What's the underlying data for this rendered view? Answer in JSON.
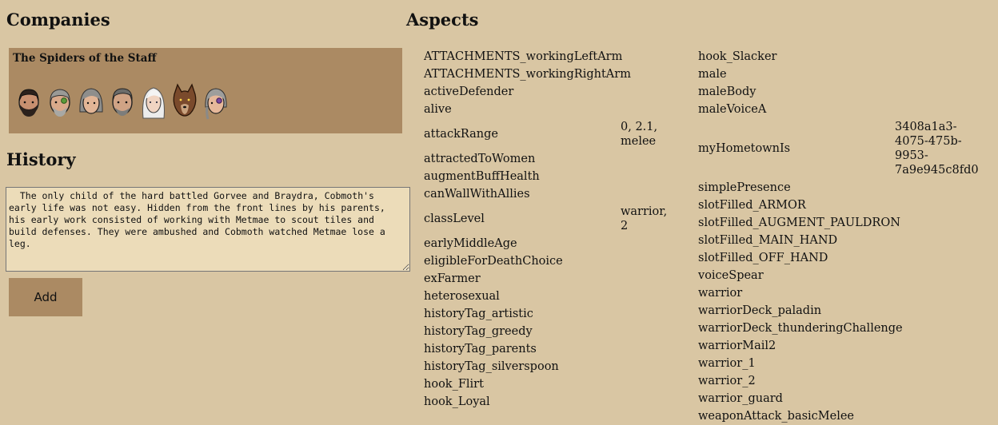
{
  "companies": {
    "heading": "Companies",
    "company_name": "The Spiders of the Staff",
    "portraits": [
      {
        "icon": "bearded-man-portrait"
      },
      {
        "icon": "old-man-green-eye-portrait"
      },
      {
        "icon": "grey-haired-woman-portrait"
      },
      {
        "icon": "grey-haired-man-portrait"
      },
      {
        "icon": "white-haired-elf-portrait"
      },
      {
        "icon": "wolf-portrait"
      },
      {
        "icon": "braided-woman-portrait"
      }
    ]
  },
  "history": {
    "heading": "History",
    "text": "  The only child of the hard battled Gorvee and Braydra, Cobmoth's early life was not easy. Hidden from the front lines by his parents, his early work consisted of working with Metmae to scout tiles and build defenses. They were ambushed and Cobmoth watched Metmae lose a leg.",
    "add_label": "Add"
  },
  "aspects": {
    "heading": "Aspects",
    "column1": [
      {
        "key": "ATTACHMENTS_workingLeftArm",
        "value": ""
      },
      {
        "key": "ATTACHMENTS_workingRightArm",
        "value": ""
      },
      {
        "key": "activeDefender",
        "value": ""
      },
      {
        "key": "alive",
        "value": ""
      },
      {
        "key": "attackRange",
        "value": "0, 2.1,\nmelee"
      },
      {
        "key": "attractedToWomen",
        "value": ""
      },
      {
        "key": "augmentBuffHealth",
        "value": ""
      },
      {
        "key": "canWallWithAllies",
        "value": ""
      },
      {
        "key": "classLevel",
        "value": "warrior,\n2"
      },
      {
        "key": "earlyMiddleAge",
        "value": ""
      },
      {
        "key": "eligibleForDeathChoice",
        "value": ""
      },
      {
        "key": "exFarmer",
        "value": ""
      },
      {
        "key": "heterosexual",
        "value": ""
      },
      {
        "key": "historyTag_artistic",
        "value": ""
      },
      {
        "key": "historyTag_greedy",
        "value": ""
      },
      {
        "key": "historyTag_parents",
        "value": ""
      },
      {
        "key": "historyTag_silverspoon",
        "value": ""
      },
      {
        "key": "hook_Flirt",
        "value": ""
      },
      {
        "key": "hook_Loyal",
        "value": ""
      }
    ],
    "column2": [
      {
        "key": "hook_Slacker",
        "value": ""
      },
      {
        "key": "male",
        "value": ""
      },
      {
        "key": "maleBody",
        "value": ""
      },
      {
        "key": "maleVoiceA",
        "value": ""
      },
      {
        "key": "myHometownIs",
        "value": "3408a1a3-\n4075-475b-\n9953-\n7a9e945c8fd0"
      },
      {
        "key": "simplePresence",
        "value": ""
      },
      {
        "key": "slotFilled_ARMOR",
        "value": ""
      },
      {
        "key": "slotFilled_AUGMENT_PAULDRON",
        "value": ""
      },
      {
        "key": "slotFilled_MAIN_HAND",
        "value": ""
      },
      {
        "key": "slotFilled_OFF_HAND",
        "value": ""
      },
      {
        "key": "voiceSpear",
        "value": ""
      },
      {
        "key": "warrior",
        "value": ""
      },
      {
        "key": "warriorDeck_paladin",
        "value": ""
      },
      {
        "key": "warriorDeck_thunderingChallenge",
        "value": ""
      },
      {
        "key": "warriorMail2",
        "value": ""
      },
      {
        "key": "warrior_1",
        "value": ""
      },
      {
        "key": "warrior_2",
        "value": ""
      },
      {
        "key": "warrior_guard",
        "value": ""
      },
      {
        "key": "weaponAttack_basicMelee",
        "value": ""
      }
    ]
  }
}
